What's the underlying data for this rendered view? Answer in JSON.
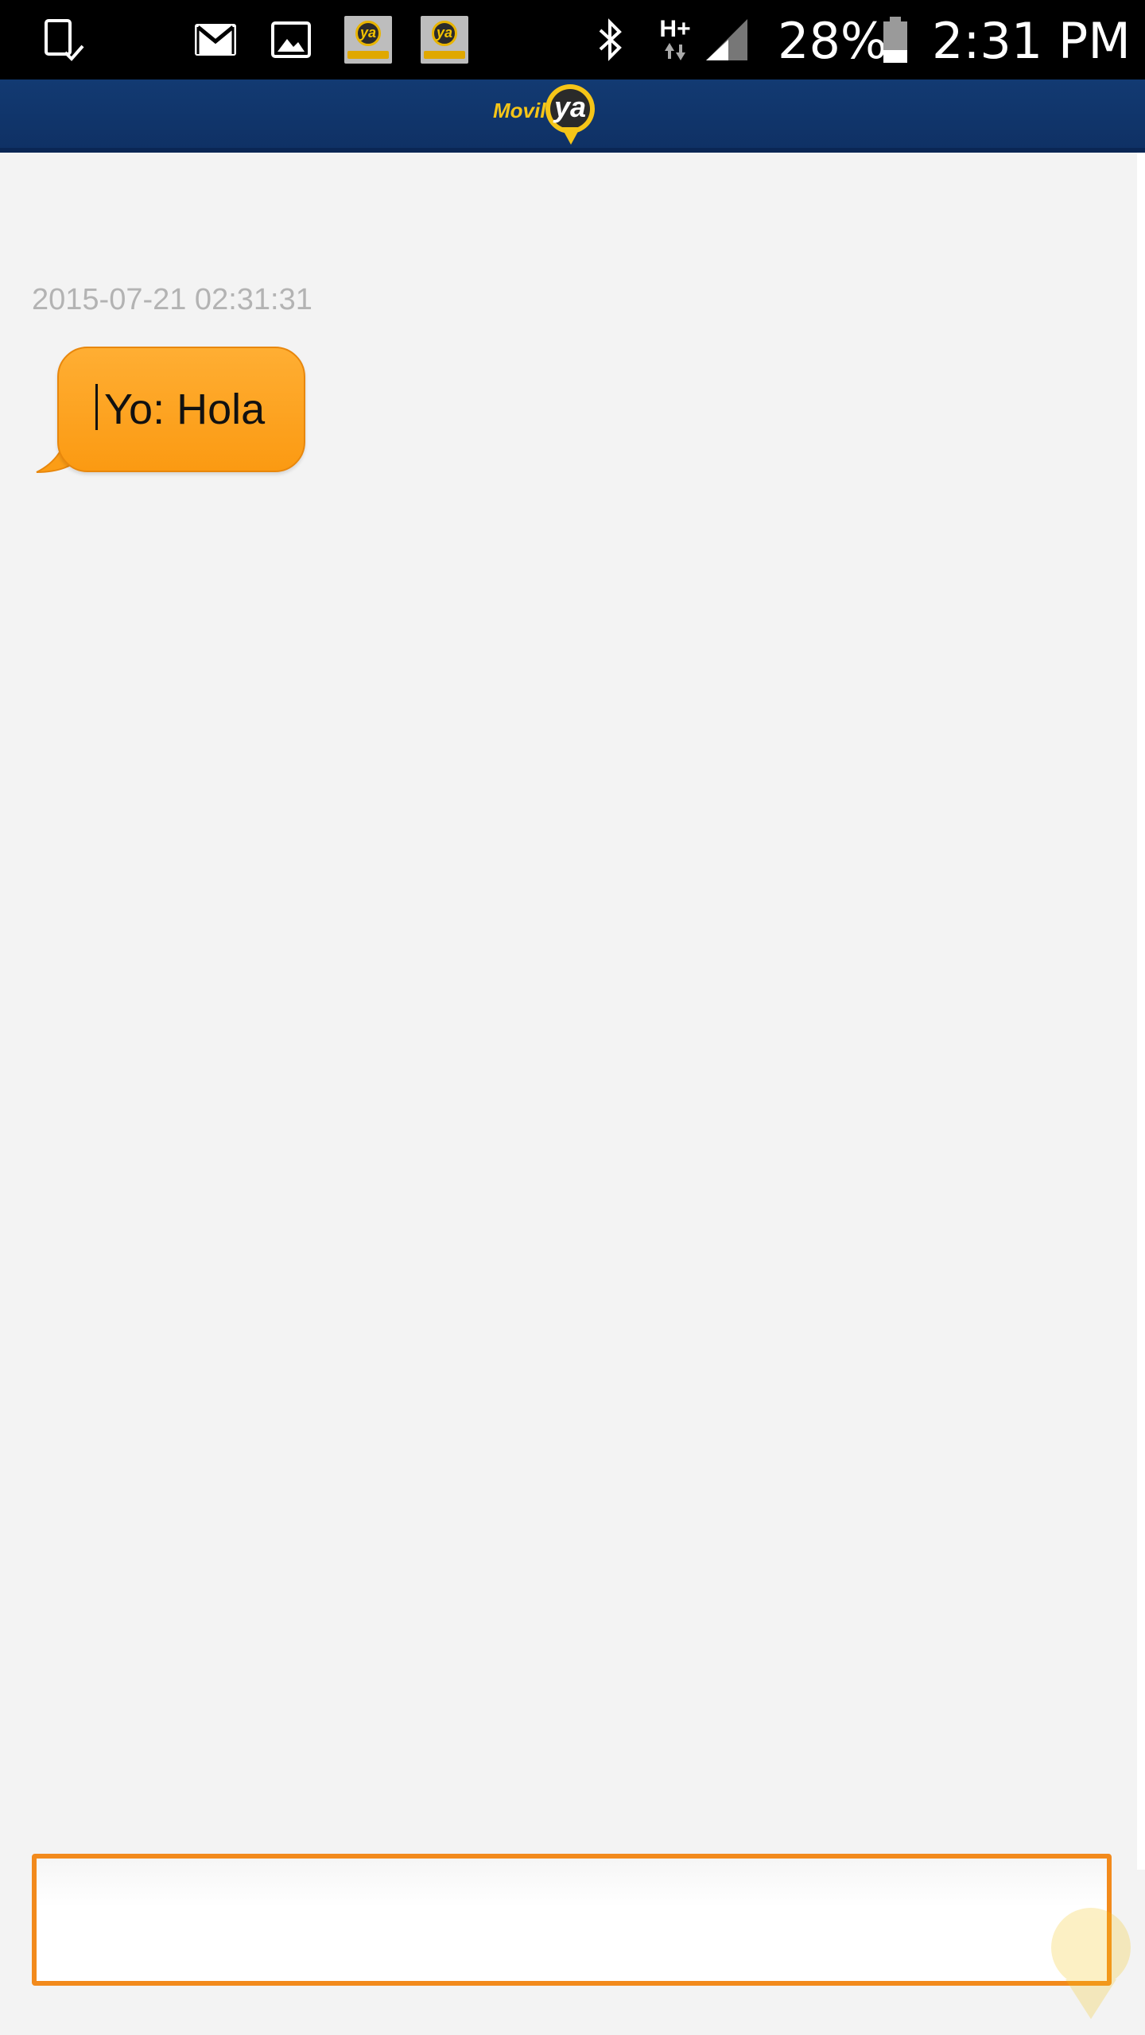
{
  "status_bar": {
    "battery_percent": "28%",
    "time": "2:31 PM",
    "network_type": "H+",
    "notification_icons": [
      "device-check-icon",
      "gmail-icon",
      "gallery-icon",
      "moviya-app-icon",
      "moviya-app-icon"
    ],
    "system_icons": [
      "bluetooth-icon",
      "network-arrows-icon",
      "signal-icon",
      "battery-icon"
    ]
  },
  "app_bar": {
    "logo_word": "Movil",
    "logo_mark": "ya",
    "brand_colors": {
      "bar": "#123a72",
      "accent": "#f5c518"
    }
  },
  "chat": {
    "messages": [
      {
        "timestamp": "2015-07-21 02:31:31",
        "text": "Yo: Hola",
        "bubble_color": "#fca21f"
      }
    ]
  },
  "composer": {
    "value": "",
    "placeholder": "",
    "border_color": "#f28a1c"
  }
}
